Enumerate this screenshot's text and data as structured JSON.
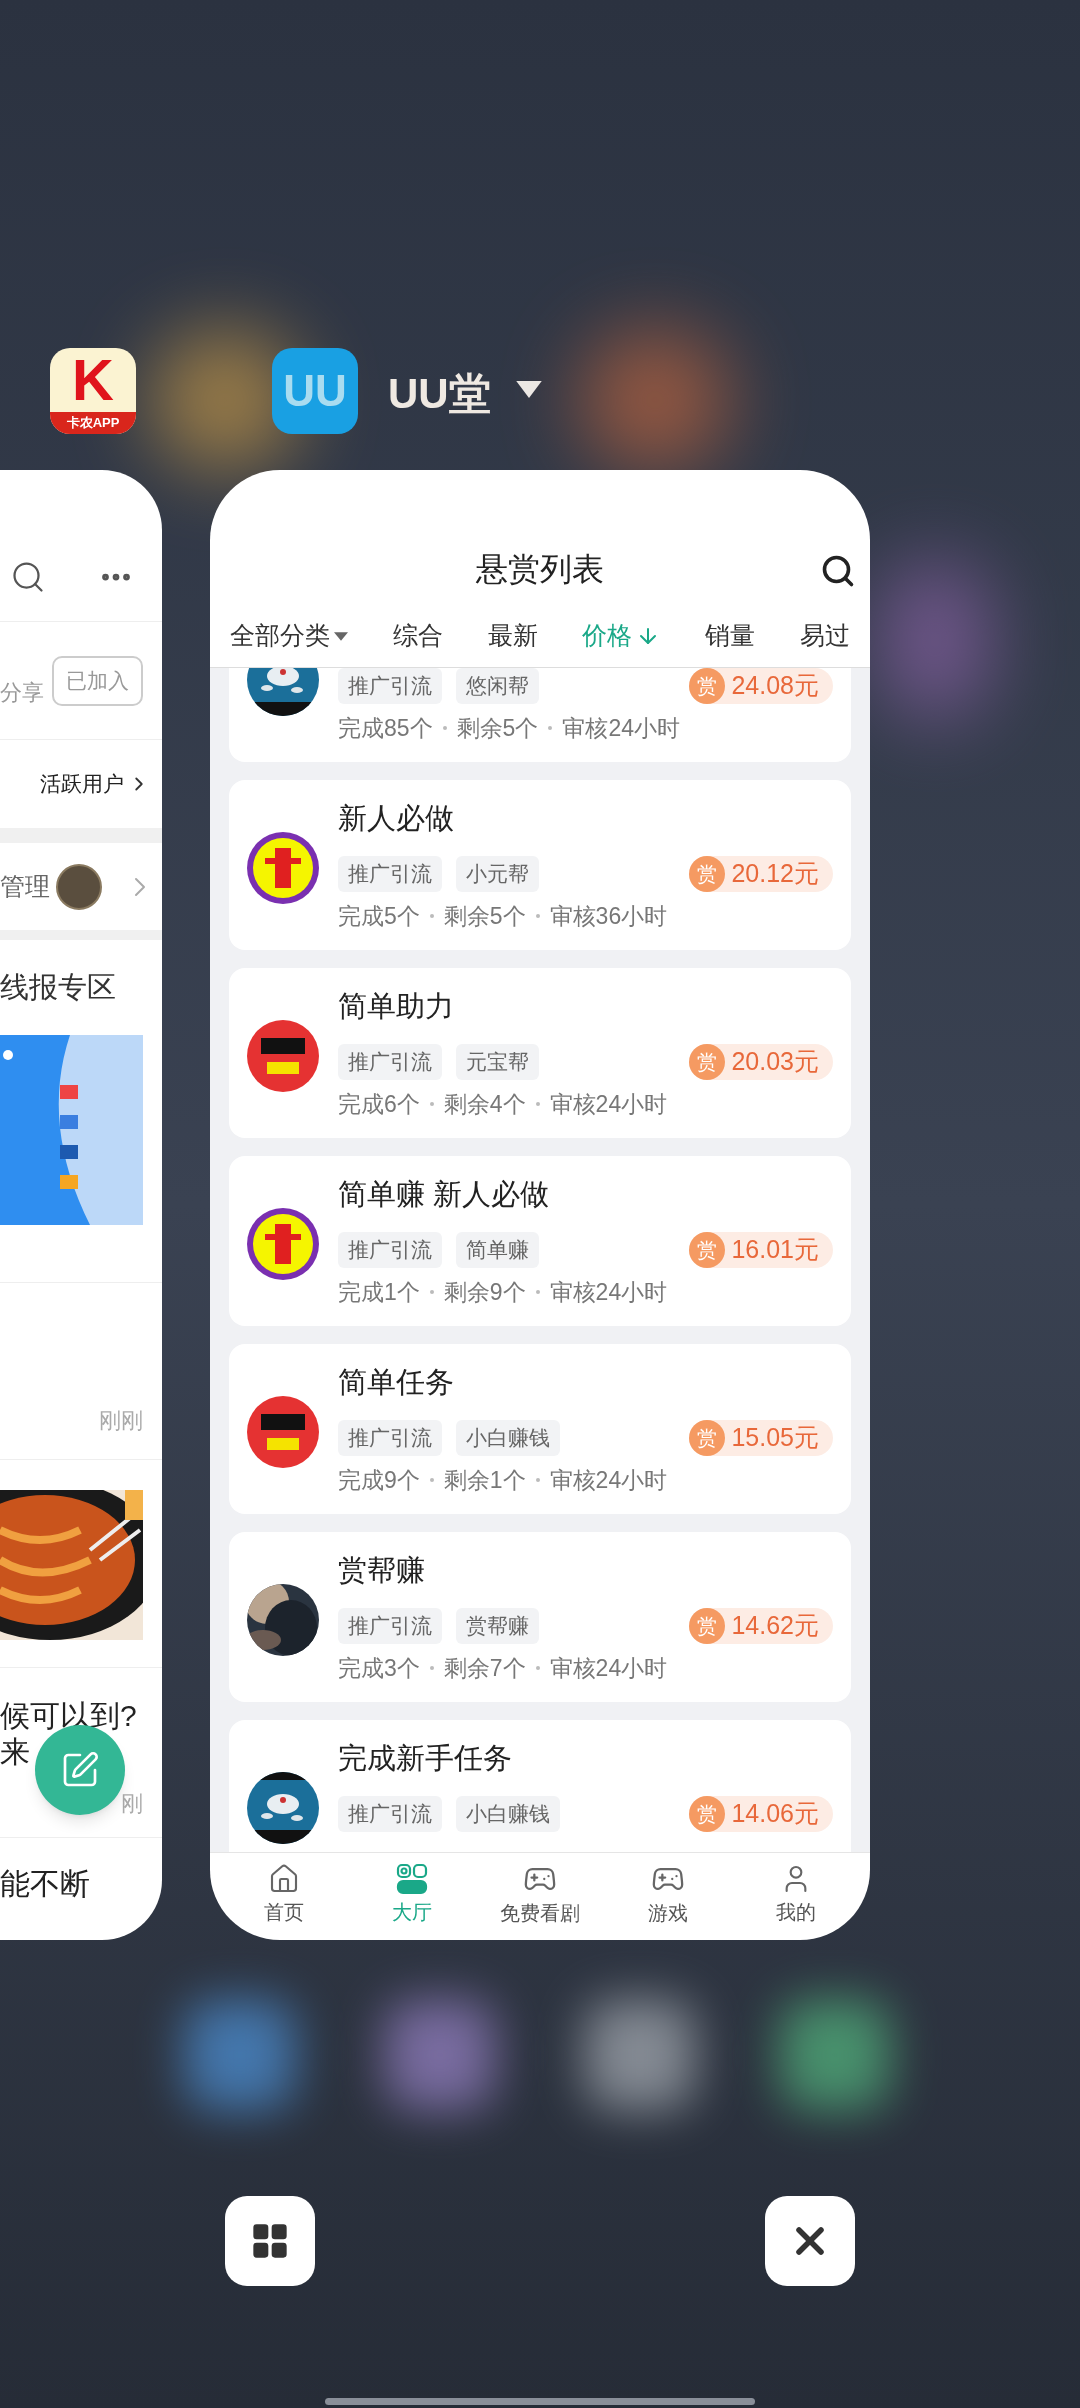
{
  "recent_apps": {
    "left_app": {
      "icon_letter": "K",
      "icon_caption": "卡农APP"
    },
    "current_app": {
      "icon_text": "UU",
      "name": "UU堂"
    }
  },
  "left_window": {
    "join_button": "已加入",
    "share_text": "分享",
    "active_users": "活跃用户",
    "manage": "管理",
    "section_title": "线报专区",
    "time_1": "刚刚",
    "post_lines": [
      "候可以到?",
      "来"
    ],
    "time_2": "刚",
    "post_text": "能不断"
  },
  "bounty_window": {
    "title": "悬赏列表",
    "filters": [
      {
        "label": "全部分类",
        "kind": "dropdown",
        "selected": false
      },
      {
        "label": "综合",
        "kind": "plain",
        "selected": false
      },
      {
        "label": "最新",
        "kind": "plain",
        "selected": false
      },
      {
        "label": "价格",
        "kind": "sort",
        "selected": true
      },
      {
        "label": "销量",
        "kind": "plain",
        "selected": false
      },
      {
        "label": "易过",
        "kind": "plain",
        "selected": false
      }
    ],
    "tasks": [
      {
        "tags": [
          "推广引流",
          "悠闲帮"
        ],
        "reward_label": "赏",
        "reward": "24.08元",
        "stats": [
          "完成85个",
          "剩余5个",
          "审核24小时"
        ]
      },
      {
        "title": "新人必做",
        "tags": [
          "推广引流",
          "小元帮"
        ],
        "reward_label": "赏",
        "reward": "20.12元",
        "stats": [
          "完成5个",
          "剩余5个",
          "审核36小时"
        ]
      },
      {
        "title": "简单助力",
        "tags": [
          "推广引流",
          "元宝帮"
        ],
        "reward_label": "赏",
        "reward": "20.03元",
        "stats": [
          "完成6个",
          "剩余4个",
          "审核24小时"
        ]
      },
      {
        "title": "简单赚 新人必做",
        "tags": [
          "推广引流",
          "简单赚"
        ],
        "reward_label": "赏",
        "reward": "16.01元",
        "stats": [
          "完成1个",
          "剩余9个",
          "审核24小时"
        ]
      },
      {
        "title": "简单任务",
        "tags": [
          "推广引流",
          "小白赚钱"
        ],
        "reward_label": "赏",
        "reward": "15.05元",
        "stats": [
          "完成9个",
          "剩余1个",
          "审核24小时"
        ]
      },
      {
        "title": "赏帮赚",
        "tags": [
          "推广引流",
          "赏帮赚"
        ],
        "reward_label": "赏",
        "reward": "14.62元",
        "stats": [
          "完成3个",
          "剩余7个",
          "审核24小时"
        ]
      },
      {
        "title": "完成新手任务",
        "tags": [
          "推广引流",
          "小白赚钱"
        ],
        "reward_label": "赏",
        "reward": "14.06元"
      }
    ],
    "nav": [
      {
        "label": "首页",
        "selected": false
      },
      {
        "label": "大厅",
        "selected": true
      },
      {
        "label": "免费看剧",
        "selected": false
      },
      {
        "label": "游戏",
        "selected": false
      },
      {
        "label": "我的",
        "selected": false
      }
    ]
  }
}
